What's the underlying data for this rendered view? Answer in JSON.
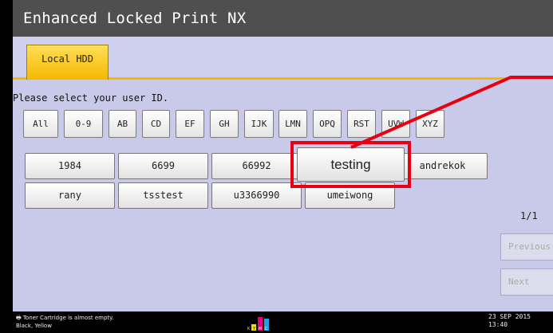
{
  "title": "Enhanced Locked Print NX",
  "tab": {
    "label": "Local HDD"
  },
  "prompt": "Please select your user ID.",
  "filters": [
    "All",
    "0-9",
    "AB",
    "CD",
    "EF",
    "GH",
    "IJK",
    "LMN",
    "OPQ",
    "RST",
    "UVW",
    "XYZ"
  ],
  "users": [
    "1984",
    "6699",
    "66992",
    "testing",
    "andrekok",
    "rany",
    "tsstest",
    "u3366990",
    "umeiwong"
  ],
  "highlighted_user": "testing",
  "page_indicator": "1/1",
  "nav": {
    "previous": "Previous",
    "next": "Next"
  },
  "status": {
    "line1": "Toner Cartridge is almost empty.",
    "line2": "Black, Yellow",
    "date": "23 SEP  2015",
    "time": "13:40",
    "toner_letters": [
      "K",
      "Y",
      "M",
      "C"
    ]
  },
  "colors": {
    "tab_accent": "#f6b900",
    "highlight": "#e60012",
    "title_bar": "#4f4f4f",
    "background": "#c9c9ea"
  }
}
